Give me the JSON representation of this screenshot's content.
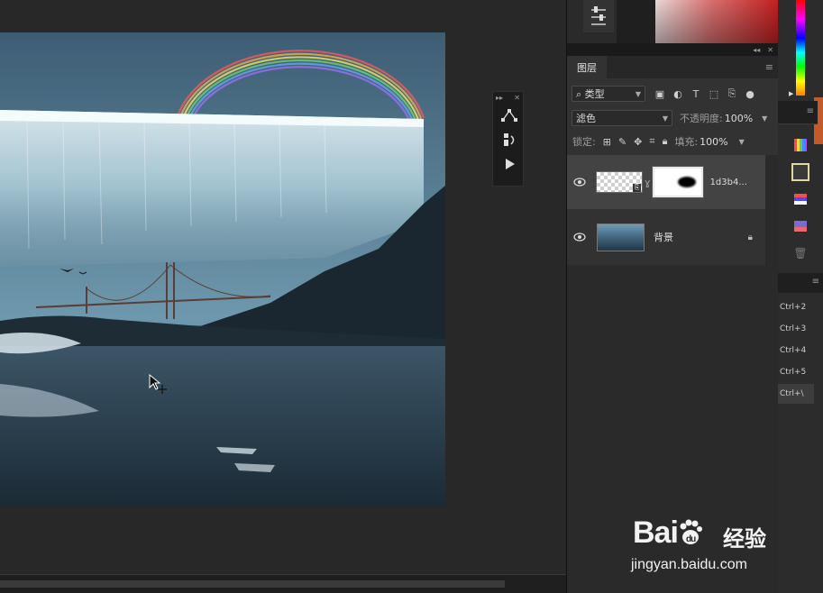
{
  "layers_panel": {
    "tab_label": "图层",
    "filter_kind": "类型",
    "blend_mode": "滤色",
    "opacity_label": "不透明度:",
    "opacity_value": "100%",
    "lock_label": "锁定:",
    "fill_label": "填充:",
    "fill_value": "100%",
    "layers": [
      {
        "name": "1d3b4...",
        "visible": true,
        "selected": true,
        "has_mask": true
      },
      {
        "name": "背景",
        "visible": true,
        "selected": false,
        "locked": true
      }
    ]
  },
  "shortcuts": [
    "Ctrl+2",
    "Ctrl+3",
    "Ctrl+4",
    "Ctrl+5",
    "Ctrl+\\"
  ],
  "icons": {
    "filter": "search-icon",
    "eye": "eye-icon",
    "lock": "lock-icon",
    "link": "chain-link-icon",
    "trash": "trash-icon"
  },
  "watermark": {
    "logo": "Bai",
    "logo_du": "du",
    "brand_cn": "经验",
    "url": "jingyan.baidu.com"
  },
  "colors": {
    "accent_red": "#c21f1f",
    "panel_bg": "#323232",
    "selected_row": "#434343"
  }
}
